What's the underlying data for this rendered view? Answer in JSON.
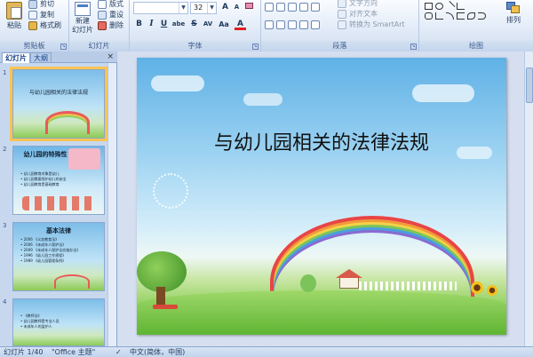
{
  "ribbon": {
    "clipboard": {
      "paste": "粘贴",
      "cut": "剪切",
      "copy": "复制",
      "format_painter": "格式刷",
      "group": "剪贴板"
    },
    "slides": {
      "new_slide": "新建\n幻灯片",
      "layout": "版式",
      "reset": "重设",
      "delete": "删除",
      "group": "幻灯片"
    },
    "font": {
      "size": "32",
      "group": "字体",
      "bold": "B",
      "italic": "I",
      "underline": "U",
      "strike": "S",
      "shadow": "abe",
      "spacing": "AV",
      "case": "Aa",
      "color": "A",
      "grow": "A",
      "shrink": "A"
    },
    "paragraph": {
      "text_direction": "文字方向",
      "align_text": "对齐文本",
      "smartart": "转换为 SmartArt",
      "group": "段落"
    },
    "drawing": {
      "arrange": "排列",
      "group": "绘图"
    }
  },
  "pane": {
    "tabs": [
      "幻灯片",
      "大纲"
    ],
    "close": "×",
    "thumbnails": [
      {
        "num": "1",
        "title": "与幼儿园相关的法律法规",
        "lines": []
      },
      {
        "num": "2",
        "title": "幼儿园的特殊性",
        "lines": [
          "• 幼儿园教育对象是幼儿",
          "• 幼儿园需要保护幼儿的安全",
          "• 幼儿园教育是基础教育"
        ]
      },
      {
        "num": "3",
        "title": "基本法律",
        "lines": [
          "• 2006 《义务教育法》",
          "• 2006 《未成年人保护法》",
          "• 2009 《未成年人保护法实施办法》",
          "• 1996 《幼儿园工作规程》",
          "• 1989 《幼儿园管理条例》"
        ]
      },
      {
        "num": "4",
        "title": "",
        "lines": [
          "• 《教师法》",
          "• 幼儿园教师是专业人员",
          "• 未成年人的监护人"
        ]
      }
    ]
  },
  "slide": {
    "title": "与幼儿园相关的法律法规"
  },
  "status": {
    "slide": "幻灯片 1/40",
    "theme": "\"Office 主题\"",
    "language": "中文(简体，中国)"
  }
}
